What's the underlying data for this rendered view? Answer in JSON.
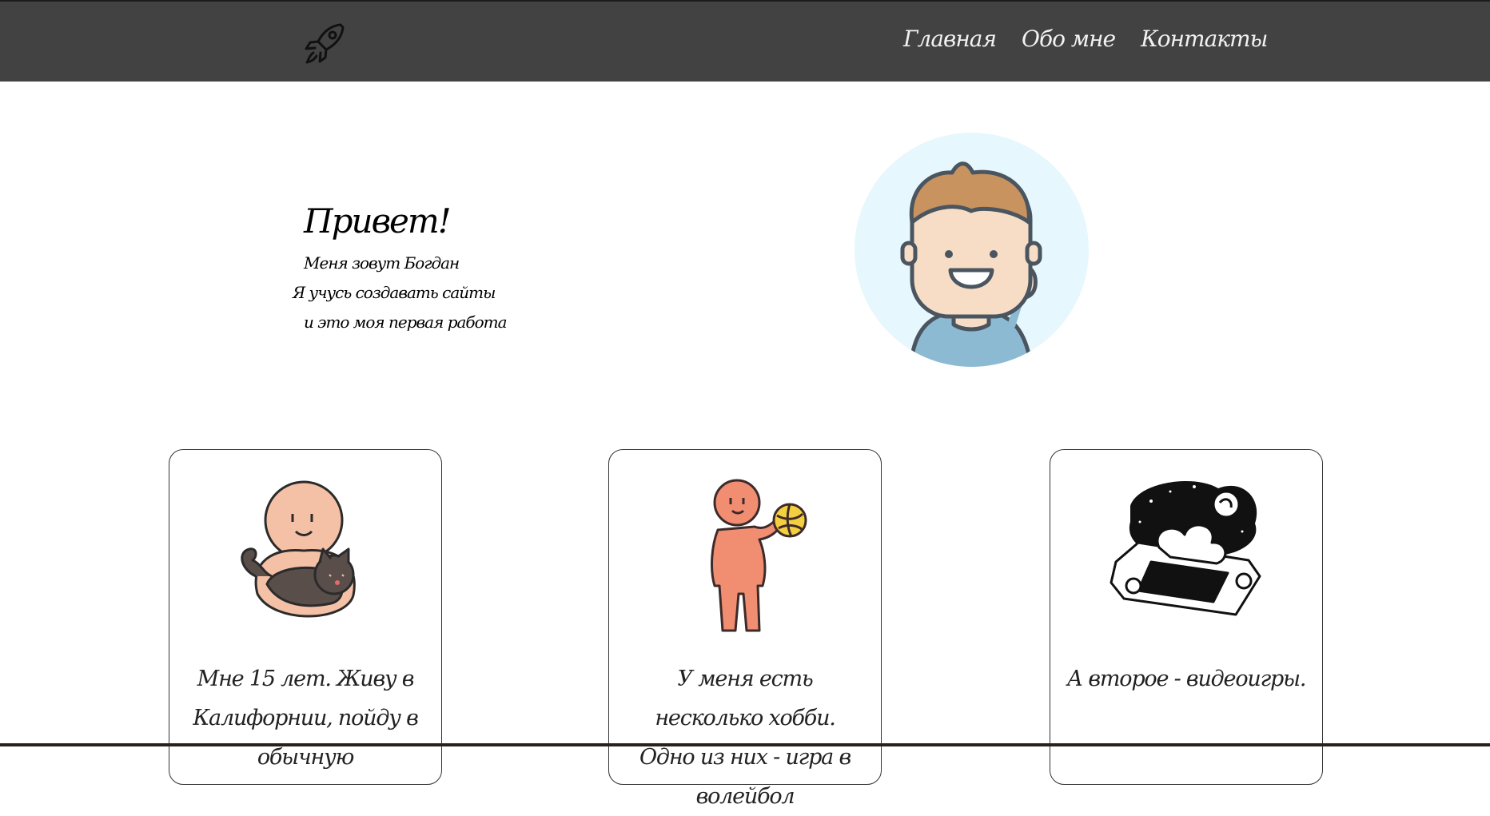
{
  "header": {
    "logo_icon": "rocket-icon",
    "nav": [
      {
        "label": "Главная"
      },
      {
        "label": "Обо мне"
      },
      {
        "label": "Контакты"
      }
    ]
  },
  "hero": {
    "title": "Привет!",
    "lines": [
      "Меня зовут Богдан",
      "Я учусь создавать сайты",
      "и это моя первая работа"
    ],
    "avatar_icon": "waving-boy-avatar"
  },
  "cards": [
    {
      "text": "Мне 15 лет. Живу в Калифорнии, пойду в обычную",
      "illustration": "person-hugging-cat"
    },
    {
      "text": "У меня есть несколько хобби. Одно из них - игра в волейбол",
      "illustration": "person-with-volleyball"
    },
    {
      "text": "А второе - видеоигры.",
      "illustration": "game-console-flowers"
    }
  ],
  "colors": {
    "header_bg": "#424242",
    "nav_text": "#f2f2f2",
    "avatar_bg": "#e6f7fd"
  }
}
